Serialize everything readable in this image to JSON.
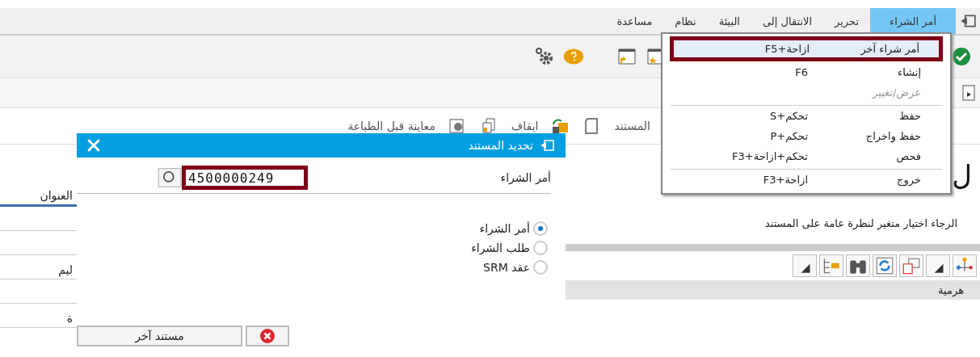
{
  "menu_bar": {
    "items": [
      {
        "label": "أمر الشراء",
        "selected": true
      },
      {
        "label": "تحرير",
        "selected": false
      },
      {
        "label": "الانتقال إلى",
        "selected": false
      },
      {
        "label": "البيئة",
        "selected": false
      },
      {
        "label": "نظام",
        "selected": false
      },
      {
        "label": "مساعدة",
        "selected": false
      }
    ]
  },
  "dropdown": {
    "items": [
      {
        "label": "أمر شراء آخر",
        "shortcut": "ازاحة+F5",
        "selected": true,
        "disabled": false,
        "separator_before": false,
        "annotated": true
      },
      {
        "label": "إنشاء",
        "shortcut": "F6",
        "selected": false,
        "disabled": false,
        "separator_before": false,
        "annotated": false
      },
      {
        "label": "عرض/تغيير",
        "selected": false,
        "disabled": true,
        "separator_before": false,
        "annotated": false
      },
      {
        "label": "حفظ",
        "shortcut": "تحكم+S",
        "selected": false,
        "disabled": false,
        "separator_before": true,
        "annotated": false
      },
      {
        "label": "حفظ واخراج",
        "shortcut": "تحكم+P",
        "selected": false,
        "disabled": false,
        "separator_before": false,
        "annotated": false
      },
      {
        "label": "فحص",
        "shortcut": "تحكم+ازاحة+F3",
        "selected": false,
        "disabled": false,
        "separator_before": false,
        "annotated": false
      },
      {
        "label": "خروج",
        "shortcut": "ازاحة+F3",
        "selected": false,
        "disabled": false,
        "separator_before": true,
        "annotated": false
      }
    ]
  },
  "app_toolbar": {
    "items": [
      "المستند",
      "ايقاف",
      "معاينة قبل الطباعة"
    ]
  },
  "main": {
    "heading": "ل",
    "instruction": "الرجاء اختيار متغير لنظرة عامة على المستند",
    "panel_header": "هرمية"
  },
  "background_form": {
    "labels": [
      "العنوان",
      "ليم",
      "ة"
    ]
  },
  "dialog": {
    "title": "تحديد المستند",
    "field": {
      "label": "أمر الشراء",
      "value": "4500000249",
      "annotated": true
    },
    "options": [
      {
        "label": "أمر الشراء",
        "selected": true
      },
      {
        "label": "طلب الشراء",
        "selected": false
      },
      {
        "label": "عقد SRM",
        "selected": false
      }
    ],
    "buttons": [
      {
        "kind": "cancel"
      },
      {
        "kind": "text",
        "label": "مستند آخر"
      }
    ]
  }
}
